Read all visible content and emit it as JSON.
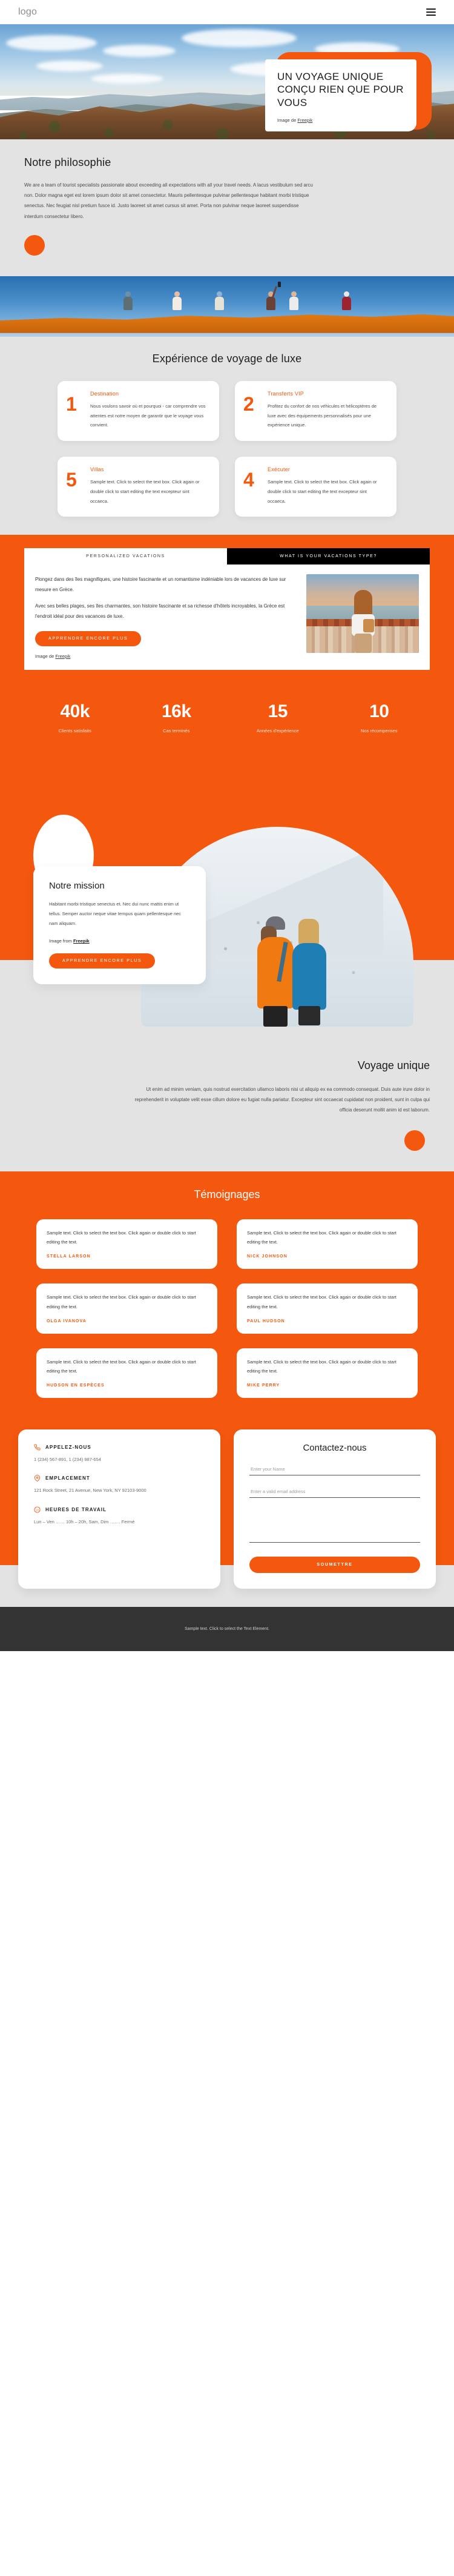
{
  "header": {
    "logo": "logo",
    "menu_icon": "hamburger-menu-icon"
  },
  "hero": {
    "title": "UN VOYAGE UNIQUE CONÇU RIEN QUE POUR VOUS",
    "credit_prefix": "Image de ",
    "credit_link": "Freepik"
  },
  "philosophy": {
    "heading": "Notre philosophie",
    "body": "We are a team of tourist specialists passionate about exceeding all expectations with all your travel needs. A lacus vestibulum sed arcu non. Dolor magna eget est lorem ipsum dolor sit amet consectetur. Mauris pellentesque pulvinar pellentesque habitant morbi tristique senectus. Nec feugiat nisl pretium fusce id. Justo laoreet sit amet cursus sit amet. Porta non pulvinar neque laoreet suspendisse interdum consectetur libero."
  },
  "luxury": {
    "heading": "Expérience de voyage de luxe",
    "cards": [
      {
        "number": "1",
        "title": "Destination",
        "text": "Nous voulons savoir où et pourquoi - car comprendre vos attentes est notre moyen de garantir que le voyage vous convient."
      },
      {
        "number": "2",
        "title": "Transferts VIP",
        "text": "Profitez du confort de nos véhicules et hélicoptères de luxe avec des équipements personnalisés pour une expérience unique."
      },
      {
        "number": "5",
        "title": "Villas",
        "text": "Sample text. Click to select the text box. Click again or double click to start editing the text excepteur sint occaeca."
      },
      {
        "number": "4",
        "title": "Exécuter",
        "text": "Sample text. Click to select the text box. Click again or double click to start editing the text excepteur sint occaeca."
      }
    ]
  },
  "tabs": {
    "active_tab": "PERSONALIZED VACATIONS",
    "inactive_tab": "WHAT IS YOUR VACATIONS TYPE?",
    "paragraph1": "Plongez dans des îles magnifiques, une histoire fascinante et un romantisme indéniable lors de vacances de luxe sur mesure en Grèce.",
    "paragraph2": "Avec ses belles plages, ses îles charmantes, son histoire fascinante et sa richesse d'hôtels incroyables, la Grèce est l'endroit idéal pour des vacances de luxe.",
    "button": "APPRENDRE ENCORE PLUS",
    "credit_prefix": "Image de ",
    "credit_link": "Freepik"
  },
  "stats": [
    {
      "value": "40k",
      "label": "Clients satisfaits"
    },
    {
      "value": "16k",
      "label": "Cas terminés"
    },
    {
      "value": "15",
      "label": "Années d'expérience"
    },
    {
      "value": "10",
      "label": "Nos récompenses"
    }
  ],
  "mission": {
    "heading": "Notre mission",
    "body": "Habitant morbi tristique senectus et. Nec dui nunc mattis enim ut tellus. Semper auctor neque vitae tempus quam pellentesque nec nam aliquam.",
    "credit_prefix": "Image from ",
    "credit_link": "Freepik",
    "button": "APPRENDRE ENCORE PLUS"
  },
  "unique": {
    "heading": "Voyage unique",
    "body": "Ut enim ad minim veniam, quis nostrud exercitation ullamco laboris nisi ut aliquip ex ea commodo consequat. Duis aute irure dolor in reprehenderit in voluptate velit esse cillum dolore eu fugiat nulla pariatur. Excepteur sint occaecat cupidatat non proident, sunt in culpa qui officia deserunt mollit anim id est laborum."
  },
  "testimonials": {
    "heading": "Témoignages",
    "items": [
      {
        "text": "Sample text. Click to select the text box. Click again or double click to start editing the text.",
        "name": "STELLA LARSON"
      },
      {
        "text": "Sample text. Click to select the text box. Click again or double click to start editing the text.",
        "name": "NICK JOHNSON"
      },
      {
        "text": "Sample text. Click to select the text box. Click again or double click to start editing the text.",
        "name": "OLGA IVANOVA"
      },
      {
        "text": "Sample text. Click to select the text box. Click again or double click to start editing the text.",
        "name": "PAUL HUDSON"
      },
      {
        "text": "Sample text. Click to select the text box. Click again or double click to start editing the text.",
        "name": "HUDSON EN ESPÈCES"
      },
      {
        "text": "Sample text. Click to select the text box. Click again or double click to start editing the text.",
        "name": "MIKE PERRY"
      }
    ]
  },
  "contact": {
    "call": {
      "icon": "phone-icon",
      "title": "APPELEZ-NOUS",
      "value": "1 (234) 567-891, 1 (234) 987-654"
    },
    "location": {
      "icon": "map-pin-icon",
      "title": "EMPLACEMENT",
      "value": "121 Rock Street, 21 Avenue, New York, NY 92103-9000"
    },
    "hours": {
      "icon": "clock-24h-icon",
      "title": "HEURES DE TRAVAIL",
      "value": "Lun – Ven …… 10h – 20h, Sam, Dim ……. Fermé"
    },
    "form": {
      "heading": "Contactez-nous",
      "name_placeholder": "Enter your Name",
      "email_placeholder": "Enter a valid email address",
      "message_placeholder": "",
      "submit": "SOUMETTRE"
    }
  },
  "footer": {
    "text": "Sample text. Click to select the Text Element."
  },
  "colors": {
    "accent": "#f4580e",
    "page_grey": "#e3e3e3",
    "footer_dark": "#333333",
    "tab_black": "#000000"
  }
}
